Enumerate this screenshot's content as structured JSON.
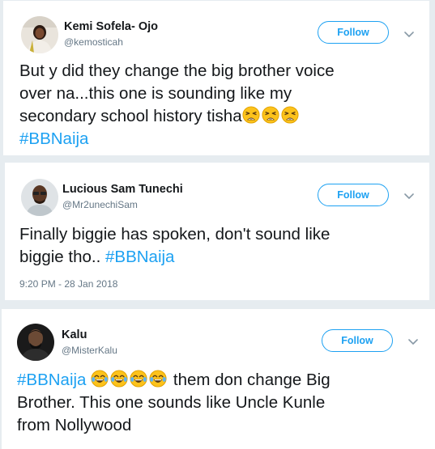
{
  "tweets": [
    {
      "display_name": "Kemi Sofela- Ojo",
      "handle": "@kemosticah",
      "follow_label": "Follow",
      "text_lines": [
        "But y did they change the big brother voice",
        "over na...this one is sounding like my",
        "secondary school history tisha"
      ],
      "hashtag": "#BBNaija",
      "emoji": "weary-face-emoji"
    },
    {
      "display_name": "Lucious Sam Tunechi",
      "handle": "@Mr2unechiSam",
      "follow_label": "Follow",
      "text_lines": [
        "Finally biggie has spoken, don't sound like",
        "biggie tho.. "
      ],
      "hashtag": "#BBNaija",
      "timestamp": "9:20 PM - 28 Jan 2018"
    },
    {
      "display_name": "Kalu",
      "handle": "@MisterKalu",
      "follow_label": "Follow",
      "hashtag": "#BBNaija",
      "text_lines": [
        " them don change Big",
        "Brother. This one sounds like Uncle Kunle",
        "from Nollywood"
      ],
      "emoji": "tears-of-joy-emoji"
    }
  ],
  "colors": {
    "accent": "#1da1f2",
    "text": "#14171a",
    "secondary": "#657786",
    "background": "#e6ecf0"
  }
}
